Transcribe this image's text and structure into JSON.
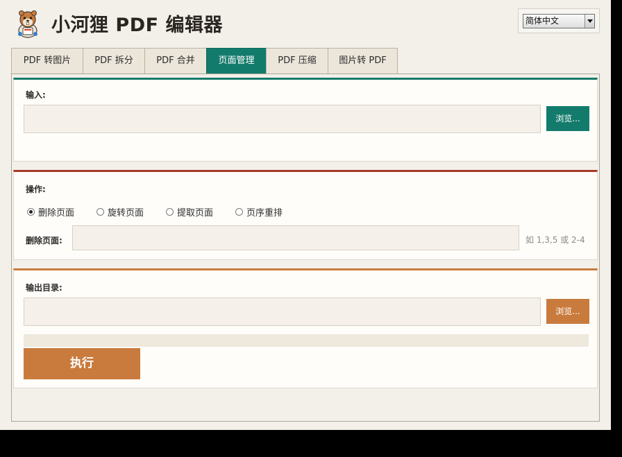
{
  "app": {
    "title": "小河狸 PDF 编辑器",
    "language": {
      "selected": "简体中文"
    }
  },
  "tabs": [
    {
      "label": "PDF 转图片",
      "active": false
    },
    {
      "label": "PDF 拆分",
      "active": false
    },
    {
      "label": "PDF 合并",
      "active": false
    },
    {
      "label": "页面管理",
      "active": true
    },
    {
      "label": "PDF 压缩",
      "active": false
    },
    {
      "label": "图片转 PDF",
      "active": false
    }
  ],
  "input_section": {
    "label": "输入:",
    "value": "",
    "browse_label": "浏览..."
  },
  "operation_section": {
    "label": "操作:",
    "options": [
      {
        "label": "删除页面",
        "checked": true
      },
      {
        "label": "旋转页面",
        "checked": false
      },
      {
        "label": "提取页面",
        "checked": false
      },
      {
        "label": "页序重排",
        "checked": false
      }
    ],
    "pages_label": "删除页面:",
    "pages_value": "",
    "pages_hint": "如 1,3,5 或 2-4"
  },
  "output_section": {
    "label": "输出目录:",
    "value": "",
    "browse_label": "浏览...",
    "progress": 0,
    "run_label": "执行"
  },
  "colors": {
    "accent_teal": "#137b6c",
    "accent_red": "#a73a26",
    "accent_orange": "#c97b3d",
    "background": "#f3f0ea"
  }
}
